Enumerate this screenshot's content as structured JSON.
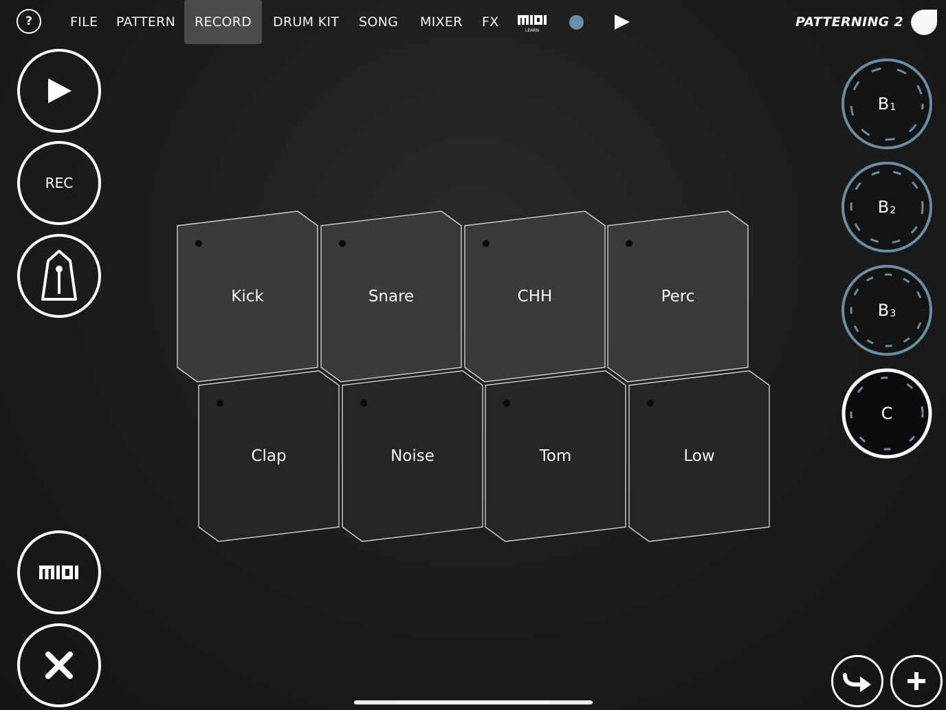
{
  "menu": {
    "help": "?",
    "items": [
      "FILE",
      "PATTERN",
      "RECORD",
      "DRUM KIT",
      "SONG",
      "MIXER",
      "FX"
    ],
    "active": "RECORD",
    "midi_learn_icon": "midi-learn-icon",
    "record_dot_color": "#6b8ea6",
    "song_title": "PATTERNING 2"
  },
  "left_controls": {
    "play_icon": "play-icon",
    "rec_label": "REC",
    "metronome_icon": "metronome-icon",
    "midi_icon": "midi-icon",
    "close_icon": "close-icon"
  },
  "pads": [
    {
      "label": "Kick"
    },
    {
      "label": "Snare"
    },
    {
      "label": "CHH"
    },
    {
      "label": "Perc"
    },
    {
      "label": "Clap"
    },
    {
      "label": "Noise"
    },
    {
      "label": "Tom"
    },
    {
      "label": "Low"
    }
  ],
  "banks": [
    {
      "letter": "B",
      "sub": "1",
      "active": false
    },
    {
      "letter": "B",
      "sub": "2",
      "active": false
    },
    {
      "letter": "B",
      "sub": "3",
      "active": false
    },
    {
      "letter": "C",
      "sub": "",
      "active": true
    }
  ],
  "colors": {
    "accent": "#6b8ea6",
    "pad_top_row": "#3a3a3a",
    "pad_bottom_row": "#262626"
  },
  "bottom_right": {
    "redo_icon": "redo-arrow-icon",
    "add_icon": "plus-icon"
  }
}
